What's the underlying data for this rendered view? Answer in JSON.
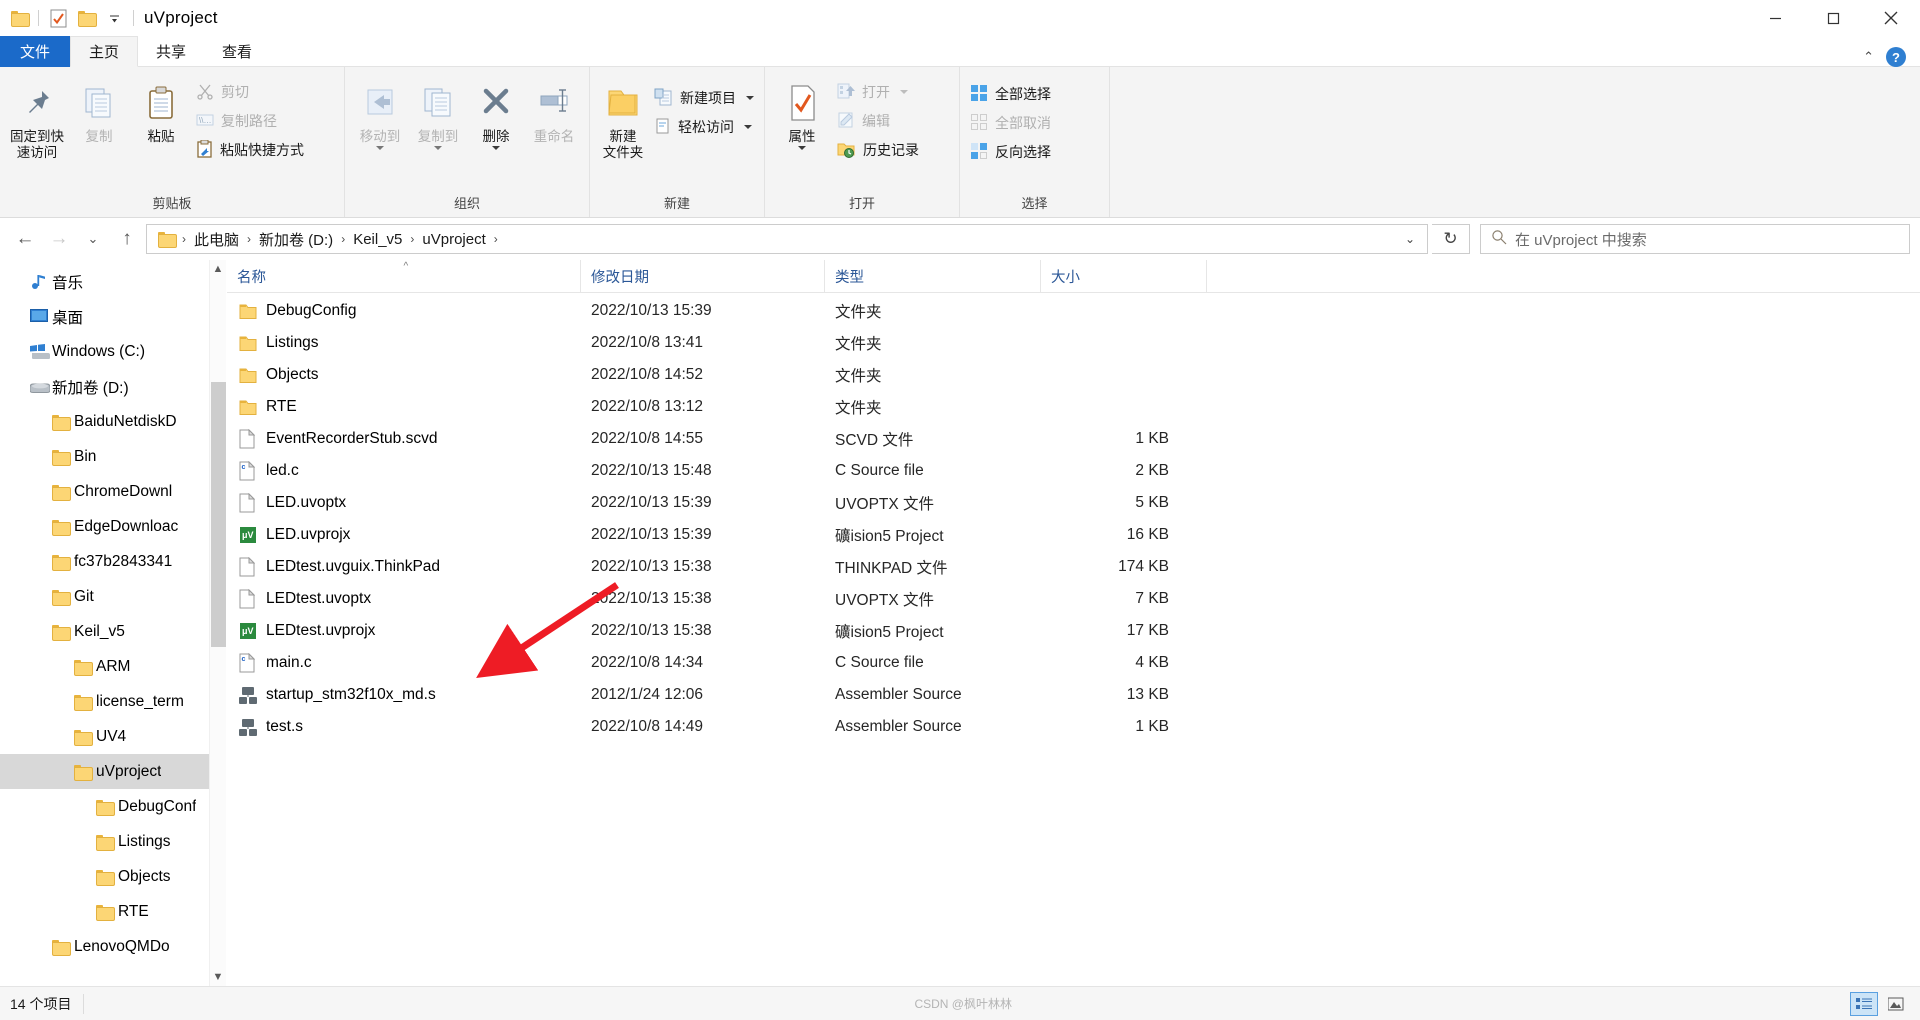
{
  "window": {
    "title": "uVproject",
    "quick_access": [
      "folder-icon",
      "properties-check-icon",
      "new-folder-icon",
      "customize-dropdown"
    ],
    "minimize": "—",
    "maximize": "❐",
    "close": "✕"
  },
  "tabs": [
    {
      "label": "文件",
      "type": "file"
    },
    {
      "label": "主页",
      "type": "active"
    },
    {
      "label": "共享",
      "type": "normal"
    },
    {
      "label": "查看",
      "type": "normal"
    }
  ],
  "ribbon": {
    "collapse_icon": "⌃",
    "help_icon": "?",
    "groups": [
      {
        "label": "剪贴板",
        "big": [
          {
            "label": "固定到快\n速访问",
            "icon": "pin-icon",
            "disabled": false
          },
          {
            "label": "复制",
            "icon": "copy-icon",
            "disabled": true
          },
          {
            "label": "粘贴",
            "icon": "paste-icon",
            "disabled": false
          }
        ],
        "small": [
          {
            "label": "剪切",
            "icon": "scissors-icon",
            "disabled": true
          },
          {
            "label": "复制路径",
            "icon": "copy-path-icon",
            "disabled": true
          },
          {
            "label": "粘贴快捷方式",
            "icon": "paste-shortcut-icon",
            "disabled": false
          }
        ]
      },
      {
        "label": "组织",
        "big": [
          {
            "label": "移动到",
            "icon": "move-to-icon",
            "disabled": true,
            "caret": true
          },
          {
            "label": "复制到",
            "icon": "copy-to-icon",
            "disabled": true,
            "caret": true
          },
          {
            "label": "删除",
            "icon": "delete-x-icon",
            "disabled": false,
            "caret": true
          },
          {
            "label": "重命名",
            "icon": "rename-icon",
            "disabled": true
          }
        ],
        "small": []
      },
      {
        "label": "新建",
        "big": [
          {
            "label": "新建\n文件夹",
            "icon": "new-folder-icon",
            "disabled": false
          }
        ],
        "small": [
          {
            "label": "新建项目",
            "icon": "new-item-icon",
            "disabled": false,
            "caret": true
          },
          {
            "label": "轻松访问",
            "icon": "easy-access-icon",
            "disabled": false,
            "caret": true
          }
        ]
      },
      {
        "label": "打开",
        "big": [
          {
            "label": "属性",
            "icon": "properties-icon",
            "disabled": false,
            "caret": true
          }
        ],
        "small": [
          {
            "label": "打开",
            "icon": "open-icon",
            "disabled": true,
            "caret": true
          },
          {
            "label": "编辑",
            "icon": "edit-icon",
            "disabled": true
          },
          {
            "label": "历史记录",
            "icon": "history-icon",
            "disabled": false
          }
        ]
      },
      {
        "label": "选择",
        "big": [],
        "small": [
          {
            "label": "全部选择",
            "icon": "select-all-icon",
            "disabled": false
          },
          {
            "label": "全部取消",
            "icon": "select-none-icon",
            "disabled": true
          },
          {
            "label": "反向选择",
            "icon": "invert-selection-icon",
            "disabled": false
          }
        ]
      }
    ]
  },
  "address": {
    "back": "←",
    "forward": "→",
    "recent": "⌄",
    "up": "↑",
    "breadcrumbs": [
      "此电脑",
      "新加卷 (D:)",
      "Keil_v5",
      "uVproject"
    ],
    "separator": "›",
    "dropdown": "⌄",
    "refresh": "↻"
  },
  "search": {
    "icon": "search-icon",
    "placeholder": "在 uVproject 中搜索"
  },
  "nav_tree": [
    {
      "label": "音乐",
      "icon": "music-icon",
      "indent": 1,
      "selected": false
    },
    {
      "label": "桌面",
      "icon": "desktop-icon",
      "indent": 1,
      "selected": false
    },
    {
      "label": "Windows (C:)",
      "icon": "windows-drive-icon",
      "indent": 1,
      "selected": false
    },
    {
      "label": "新加卷 (D:)",
      "icon": "drive-icon",
      "indent": 1,
      "selected": false
    },
    {
      "label": "BaiduNetdiskD",
      "icon": "folder-icon",
      "indent": 2,
      "selected": false
    },
    {
      "label": "Bin",
      "icon": "folder-icon",
      "indent": 2,
      "selected": false
    },
    {
      "label": "ChromeDownl",
      "icon": "folder-icon",
      "indent": 2,
      "selected": false
    },
    {
      "label": "EdgeDownloac",
      "icon": "folder-icon",
      "indent": 2,
      "selected": false
    },
    {
      "label": "fc37b2843341",
      "icon": "folder-icon",
      "indent": 2,
      "selected": false
    },
    {
      "label": "Git",
      "icon": "folder-icon",
      "indent": 2,
      "selected": false
    },
    {
      "label": "Keil_v5",
      "icon": "folder-icon",
      "indent": 2,
      "selected": false
    },
    {
      "label": "ARM",
      "icon": "folder-icon",
      "indent": 3,
      "selected": false
    },
    {
      "label": "license_term",
      "icon": "folder-icon",
      "indent": 3,
      "selected": false
    },
    {
      "label": "UV4",
      "icon": "folder-icon",
      "indent": 3,
      "selected": false
    },
    {
      "label": "uVproject",
      "icon": "folder-icon",
      "indent": 3,
      "selected": true
    },
    {
      "label": "DebugConf",
      "icon": "folder-icon",
      "indent": 4,
      "selected": false
    },
    {
      "label": "Listings",
      "icon": "folder-icon",
      "indent": 4,
      "selected": false
    },
    {
      "label": "Objects",
      "icon": "folder-icon",
      "indent": 4,
      "selected": false
    },
    {
      "label": "RTE",
      "icon": "folder-icon",
      "indent": 4,
      "selected": false
    },
    {
      "label": "LenovoQMDo",
      "icon": "folder-icon",
      "indent": 2,
      "selected": false
    }
  ],
  "columns": [
    {
      "label": "名称",
      "sorted": true
    },
    {
      "label": "修改日期",
      "sorted": false
    },
    {
      "label": "类型",
      "sorted": false
    },
    {
      "label": "大小",
      "sorted": false
    }
  ],
  "files": [
    {
      "name": "DebugConfig",
      "date": "2022/10/13 15:39",
      "type": "文件夹",
      "size": "",
      "icon": "folder-icon"
    },
    {
      "name": "Listings",
      "date": "2022/10/8 13:41",
      "type": "文件夹",
      "size": "",
      "icon": "folder-icon"
    },
    {
      "name": "Objects",
      "date": "2022/10/8 14:52",
      "type": "文件夹",
      "size": "",
      "icon": "folder-icon"
    },
    {
      "name": "RTE",
      "date": "2022/10/8 13:12",
      "type": "文件夹",
      "size": "",
      "icon": "folder-icon"
    },
    {
      "name": "EventRecorderStub.scvd",
      "date": "2022/10/8 14:55",
      "type": "SCVD 文件",
      "size": "1 KB",
      "icon": "document-icon"
    },
    {
      "name": "led.c",
      "date": "2022/10/13 15:48",
      "type": "C Source file",
      "size": "2 KB",
      "icon": "c-source-icon"
    },
    {
      "name": "LED.uvoptx",
      "date": "2022/10/13 15:39",
      "type": "UVOPTX 文件",
      "size": "5 KB",
      "icon": "document-icon"
    },
    {
      "name": "LED.uvprojx",
      "date": "2022/10/13 15:39",
      "type": "礦ision5 Project",
      "size": "16 KB",
      "icon": "uvision-icon"
    },
    {
      "name": "LEDtest.uvguix.ThinkPad",
      "date": "2022/10/13 15:38",
      "type": "THINKPAD 文件",
      "size": "174 KB",
      "icon": "document-icon"
    },
    {
      "name": "LEDtest.uvoptx",
      "date": "2022/10/13 15:38",
      "type": "UVOPTX 文件",
      "size": "7 KB",
      "icon": "document-icon"
    },
    {
      "name": "LEDtest.uvprojx",
      "date": "2022/10/13 15:38",
      "type": "礦ision5 Project",
      "size": "17 KB",
      "icon": "uvision-icon"
    },
    {
      "name": "main.c",
      "date": "2022/10/8 14:34",
      "type": "C Source file",
      "size": "4 KB",
      "icon": "c-source-icon"
    },
    {
      "name": "startup_stm32f10x_md.s",
      "date": "2012/1/24 12:06",
      "type": "Assembler Source",
      "size": "13 KB",
      "icon": "assembler-icon"
    },
    {
      "name": "test.s",
      "date": "2022/10/8 14:49",
      "type": "Assembler Source",
      "size": "1 KB",
      "icon": "assembler-icon"
    }
  ],
  "annotation": {
    "type": "red-arrow",
    "color": "#ee1c25",
    "points_to": "startup_stm32f10x_md.s"
  },
  "status": {
    "item_count": "14 个项目",
    "watermark": "CSDN @枫叶林林",
    "views": [
      {
        "name": "details-view",
        "active": true
      },
      {
        "name": "large-icons-view",
        "active": false
      }
    ]
  }
}
